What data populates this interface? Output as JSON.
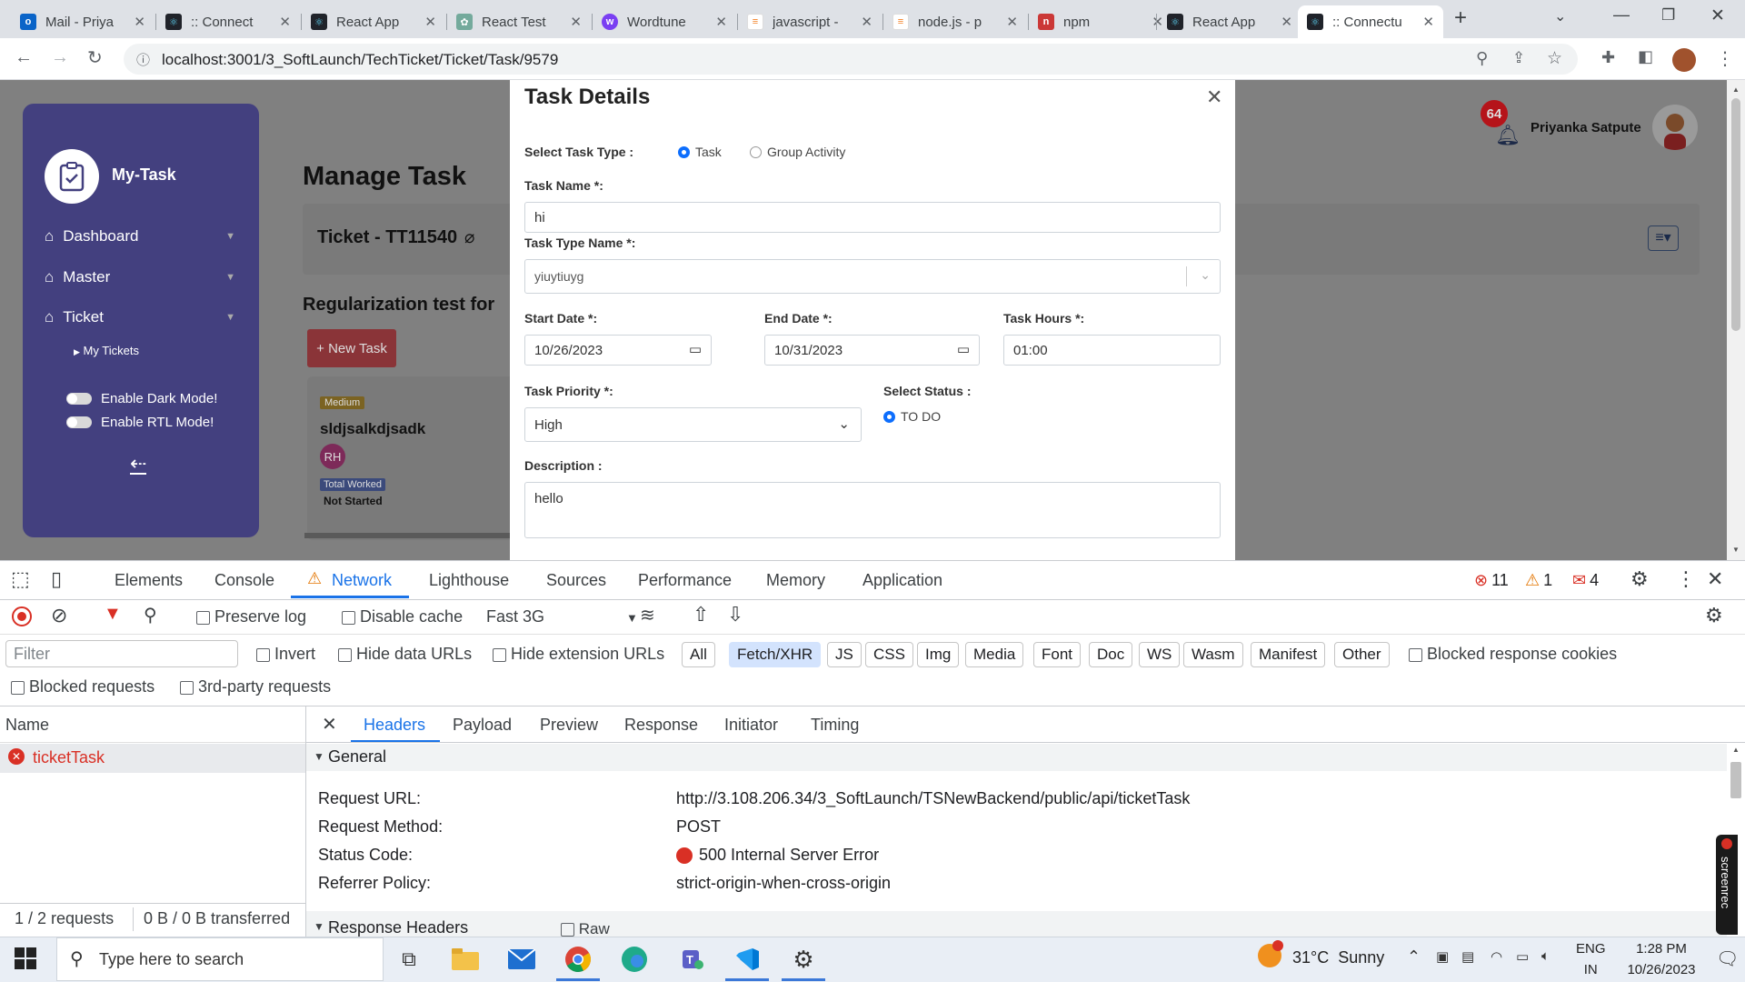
{
  "browser": {
    "tabs": [
      {
        "label": "Mail - Priya",
        "active": false
      },
      {
        "label": ":: Connect",
        "active": false
      },
      {
        "label": "React App",
        "active": false
      },
      {
        "label": "React Test",
        "active": false
      },
      {
        "label": "Wordtune",
        "active": false
      },
      {
        "label": "javascript -",
        "active": false
      },
      {
        "label": "node.js - p",
        "active": false
      },
      {
        "label": "npm",
        "active": false
      },
      {
        "label": "React App",
        "active": false
      },
      {
        "label": ":: Connectu",
        "active": true
      }
    ],
    "url": "localhost:3001/3_SoftLaunch/TechTicket/Ticket/Task/9579"
  },
  "app": {
    "brand": "My-Task",
    "nav": [
      {
        "label": "Dashboard"
      },
      {
        "label": "Master"
      },
      {
        "label": "Ticket"
      }
    ],
    "subnav": "My Tickets",
    "dark_mode_label": "Enable Dark Mode!",
    "rtl_mode_label": "Enable RTL Mode!",
    "page_title": "Manage Task",
    "ticket_title": "Ticket - TT11540",
    "section_title": "Regularization test for",
    "new_task_label": "+ New Task",
    "card": {
      "priority_badge": "Medium",
      "title": "sldjsalkdjsadk",
      "avatar_initials": "RH",
      "worked_badge": "Total Worked",
      "status": "Not Started"
    },
    "notifications_count": "64",
    "user_name": "Priyanka Satpute"
  },
  "modal": {
    "title": "Task Details",
    "task_type_label": "Select Task Type :",
    "task_type_options": [
      "Task",
      "Group Activity"
    ],
    "task_name_label": "Task Name *:",
    "task_name_value": "hi",
    "task_type_name_label": "Task Type Name *:",
    "task_type_name_value": "yiuytiuyg",
    "start_date_label": "Start Date *:",
    "start_date_value": "10/26/2023",
    "end_date_label": "End Date *:",
    "end_date_value": "10/31/2023",
    "task_hours_label": "Task Hours *:",
    "task_hours_value": "01:00",
    "priority_label": "Task Priority *:",
    "priority_value": "High",
    "status_label": "Select Status :",
    "status_value": "TO DO",
    "description_label": "Description :",
    "description_value": "hello"
  },
  "devtools": {
    "tabs": [
      "Elements",
      "Console",
      "Network",
      "Lighthouse",
      "Sources",
      "Performance",
      "Memory",
      "Application"
    ],
    "active_tab": "Network",
    "errors_count": "11",
    "warnings_count": "1",
    "issues_count": "4",
    "preserve_log": "Preserve log",
    "disable_cache": "Disable cache",
    "throttle": "Fast 3G",
    "filter_placeholder": "Filter",
    "invert": "Invert",
    "hide_data_urls": "Hide data URLs",
    "hide_ext_urls": "Hide extension URLs",
    "type_filters": [
      "All",
      "Fetch/XHR",
      "JS",
      "CSS",
      "Img",
      "Media",
      "Font",
      "Doc",
      "WS",
      "Wasm",
      "Manifest",
      "Other"
    ],
    "active_filter": "Fetch/XHR",
    "blocked_cookies": "Blocked response cookies",
    "blocked_requests": "Blocked requests",
    "third_party": "3rd-party requests",
    "name_header": "Name",
    "requests": [
      {
        "name": "ticketTask",
        "error": true
      }
    ],
    "footer_requests": "1 / 2 requests",
    "footer_transferred": "0 B / 0 B transferred",
    "detail_tabs": [
      "Headers",
      "Payload",
      "Preview",
      "Response",
      "Initiator",
      "Timing"
    ],
    "active_detail_tab": "Headers",
    "general_label": "General",
    "general": [
      {
        "key": "Request URL:",
        "value": "http://3.108.206.34/3_SoftLaunch/TSNewBackend/public/api/ticketTask"
      },
      {
        "key": "Request Method:",
        "value": "POST"
      },
      {
        "key": "Status Code:",
        "value": "500 Internal Server Error"
      },
      {
        "key": "Referrer Policy:",
        "value": "strict-origin-when-cross-origin"
      }
    ],
    "response_headers_label": "Response Headers",
    "raw_label": "Raw"
  },
  "taskbar": {
    "search_placeholder": "Type here to search",
    "weather": "31°C  Sunny",
    "lang_top": "ENG",
    "lang_bottom": "IN",
    "time": "1:28 PM",
    "date": "10/26/2023"
  },
  "colors": {
    "sidebar": "#43407f",
    "accent": "#0d6efd",
    "new_task": "#d9464b",
    "error": "#d93025",
    "badge_medium": "#e8b21b"
  }
}
